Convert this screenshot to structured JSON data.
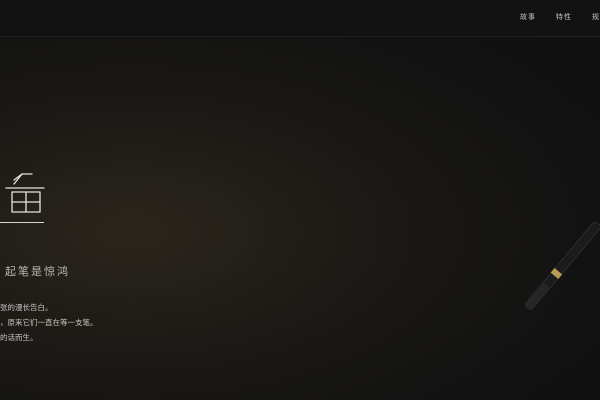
{
  "nav": {
    "items": [
      "故事",
      "特性",
      "规"
    ]
  },
  "hero": {
    "title_char": "鱼",
    "tagline": "起笔是惊鸿"
  },
  "description": {
    "lines": [
      "张的漫长告白。",
      "，原来它们一直在等一支笔。",
      "的话而生。"
    ]
  }
}
